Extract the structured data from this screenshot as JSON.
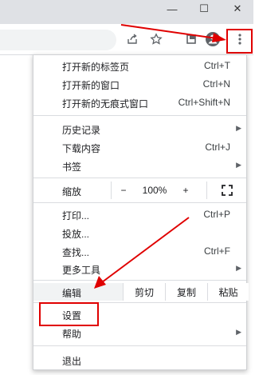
{
  "window": {
    "minimize_glyph": "—",
    "maximize_glyph": "☐",
    "close_glyph": "✕"
  },
  "toolbar_icons": [
    "share-icon",
    "bookmark-star-icon",
    "tab-search-icon",
    "profile-avatar-icon",
    "more-vert-icon"
  ],
  "menu": {
    "items_top": [
      {
        "label": "打开新的标签页",
        "shortcut": "Ctrl+T"
      },
      {
        "label": "打开新的窗口",
        "shortcut": "Ctrl+N"
      },
      {
        "label": "打开新的无痕式窗口",
        "shortcut": "Ctrl+Shift+N"
      }
    ],
    "history": {
      "label": "历史记录"
    },
    "downloads": {
      "label": "下载内容",
      "shortcut": "Ctrl+J"
    },
    "bookmarks": {
      "label": "书签"
    },
    "zoom": {
      "label": "缩放",
      "minus": "−",
      "value": "100%",
      "plus": "+"
    },
    "print": {
      "label": "打印...",
      "shortcut": "Ctrl+P"
    },
    "cast": {
      "label": "投放..."
    },
    "find": {
      "label": "查找...",
      "shortcut": "Ctrl+F"
    },
    "more_tools": {
      "label": "更多工具"
    },
    "edit": {
      "label": "编辑",
      "cut": "剪切",
      "copy": "复制",
      "paste": "粘贴"
    },
    "settings": {
      "label": "设置"
    },
    "help": {
      "label": "帮助"
    },
    "exit": {
      "label": "退出"
    }
  },
  "annotation_color": "#e00000"
}
